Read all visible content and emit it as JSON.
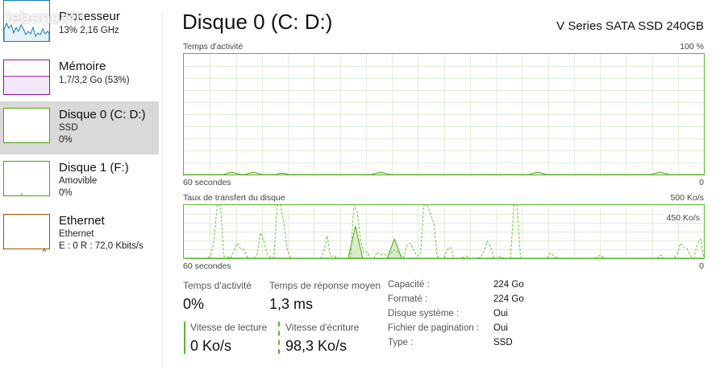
{
  "sidebar": {
    "items": [
      {
        "title": "Processeur",
        "line1": "13% 2,16 GHz",
        "line2": ""
      },
      {
        "title": "Mémoire",
        "line1": "1,7/3,2 Go (53%)",
        "line2": ""
      },
      {
        "title": "Disque 0 (C: D:)",
        "line1": "SSD",
        "line2": "0%"
      },
      {
        "title": "Disque 1 (F:)",
        "line1": "Amovible",
        "line2": "0%"
      },
      {
        "title": "Ethernet",
        "line1": "Ethernet",
        "line2": "E : 0 R : 72,0 Kbits/s"
      }
    ],
    "colors": {
      "cpu": "#117dbb",
      "memory": "#8b12ae",
      "disk": "#4da60c",
      "ethernet": "#a74f01"
    }
  },
  "watermark": "leboncoin",
  "header": {
    "title": "Disque 0 (C: D:)",
    "model": "V Series SATA SSD 240GB"
  },
  "activity_chart": {
    "label": "Temps d'activité",
    "max_label": "100 %",
    "time_label": "60 secondes",
    "min_label": "0",
    "values": [
      0,
      0,
      0,
      0,
      0,
      0,
      0,
      0,
      0,
      0,
      1,
      2,
      1,
      0,
      0,
      1,
      2,
      1,
      0,
      0,
      0,
      0,
      1,
      1,
      0,
      0,
      0,
      0,
      0,
      0,
      0,
      0,
      0,
      0,
      0,
      0,
      0,
      0,
      0,
      0,
      0,
      0,
      0,
      0,
      1,
      2,
      1,
      0,
      0,
      0,
      0,
      0,
      0,
      0,
      0,
      0,
      0,
      0,
      0,
      0,
      0,
      0,
      0,
      0,
      0,
      0,
      0,
      0,
      0,
      0,
      0,
      0,
      0,
      0,
      0,
      0,
      0,
      0,
      0,
      0,
      1,
      2,
      1,
      0,
      0,
      0,
      0,
      0,
      0,
      0,
      0,
      0,
      0,
      0,
      0,
      0,
      0,
      0,
      0,
      0,
      0,
      0,
      0,
      0,
      0,
      0,
      0,
      0,
      1,
      2,
      1,
      0,
      0,
      0,
      0,
      0,
      0,
      0,
      0,
      0
    ]
  },
  "transfer_chart": {
    "label": "Taux de transfert du disque",
    "max_label": "500 Ko/s",
    "mid_label": "450 Ko/s",
    "time_label": "60 secondes",
    "min_label": "0",
    "write_values": [
      0,
      0,
      0,
      0,
      0,
      0,
      0,
      0,
      20,
      150,
      520,
      520,
      20,
      15,
      0,
      60,
      140,
      90,
      80,
      10,
      0,
      0,
      40,
      240,
      160,
      40,
      10,
      5,
      520,
      520,
      330,
      80,
      0,
      0,
      0,
      0,
      0,
      0,
      0,
      0,
      0,
      0,
      60,
      210,
      20,
      20,
      0,
      0,
      0,
      0,
      0,
      520,
      440,
      170,
      50,
      60,
      0,
      0,
      60,
      30,
      40,
      20,
      40,
      80,
      60,
      30,
      10,
      130,
      140,
      70,
      20,
      40,
      520,
      520,
      420,
      330,
      20,
      0,
      0,
      80,
      100,
      0,
      0,
      0,
      10,
      20,
      0,
      0,
      0,
      10,
      60,
      160,
      110,
      0,
      0,
      20,
      0,
      0,
      0,
      520,
      520,
      0,
      0,
      0,
      0,
      0,
      0,
      0,
      0,
      0,
      50,
      20,
      0,
      0,
      0,
      0,
      0,
      0,
      0,
      0,
      0,
      0,
      0,
      0,
      10,
      30,
      0,
      0,
      0,
      0,
      0,
      0,
      0,
      0,
      0,
      0,
      0,
      0,
      0,
      0,
      0,
      0,
      0,
      30,
      0,
      0,
      0,
      0,
      40,
      140,
      100,
      90,
      20,
      0,
      130,
      180,
      0
    ],
    "read_values": [
      0,
      0,
      0,
      0,
      0,
      0,
      0,
      0,
      0,
      0,
      0,
      0,
      0,
      0,
      0,
      0,
      0,
      0,
      0,
      0,
      0,
      0,
      0,
      0,
      0,
      0,
      0,
      0,
      0,
      0,
      0,
      0,
      0,
      0,
      0,
      0,
      0,
      0,
      0,
      0,
      0,
      0,
      0,
      0,
      0,
      0,
      0,
      0,
      0,
      0,
      0,
      0,
      0,
      0,
      0,
      0,
      0,
      0,
      0,
      0,
      0,
      0,
      0,
      0,
      0,
      0,
      0,
      0,
      0,
      0,
      0,
      0,
      0,
      0,
      0,
      0,
      0,
      0,
      0,
      0,
      0,
      0,
      0,
      0,
      0,
      0,
      0,
      0,
      0,
      0,
      0,
      0,
      0,
      0,
      0,
      0,
      0,
      0,
      0,
      0,
      0,
      0,
      0,
      0,
      0,
      0,
      0,
      0,
      0,
      0,
      0,
      0,
      0,
      0,
      0,
      0,
      0,
      0,
      0,
      0,
      0,
      0,
      0,
      0,
      0,
      0,
      0,
      0,
      0,
      0,
      0,
      0,
      0,
      0,
      0,
      0,
      0,
      0,
      0,
      0,
      0,
      0,
      0,
      0,
      0,
      0,
      0,
      0,
      0,
      0,
      0,
      0,
      0,
      0,
      0,
      0,
      0,
      0,
      0,
      0
    ],
    "peaks": [
      {
        "x": 0.33,
        "value": 300
      },
      {
        "x": 0.405,
        "value": 180
      }
    ]
  },
  "stats": {
    "activity": {
      "label": "Temps d'activité",
      "value": "0%"
    },
    "response": {
      "label": "Temps de réponse moyen",
      "value": "1,3 ms"
    },
    "read": {
      "label": "Vitesse de lecture",
      "value": "0 Ko/s"
    },
    "write": {
      "label": "Vitesse d'écriture",
      "value": "98,3 Ko/s"
    }
  },
  "properties": [
    {
      "key": "Capacité :",
      "value": "224 Go"
    },
    {
      "key": "Formaté :",
      "value": "224 Go"
    },
    {
      "key": "Disque système :",
      "value": "Oui"
    },
    {
      "key": "Fichier de pagination :",
      "value": "Oui"
    },
    {
      "key": "Type :",
      "value": "SSD"
    }
  ]
}
